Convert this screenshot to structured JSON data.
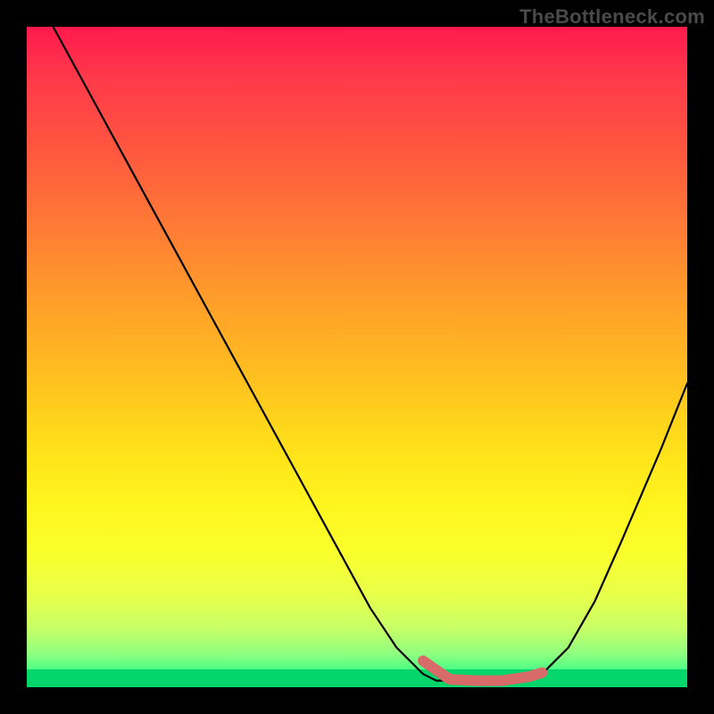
{
  "watermark": "TheBottleneck.com",
  "chart_data": {
    "type": "line",
    "title": "",
    "xlabel": "",
    "ylabel": "",
    "xlim": [
      0,
      100
    ],
    "ylim": [
      0,
      100
    ],
    "grid": false,
    "legend": false,
    "series": [
      {
        "name": "bottleneck-curve",
        "x": [
          4,
          10,
          16,
          22,
          28,
          34,
          40,
          46,
          52,
          56,
          60,
          62,
          66,
          70,
          74,
          78,
          82,
          86,
          90,
          96,
          100
        ],
        "values": [
          100,
          89,
          78,
          67,
          56,
          45,
          34,
          23,
          12,
          6,
          2,
          1,
          1,
          1,
          1,
          2,
          6,
          13,
          22,
          36,
          46
        ]
      }
    ],
    "highlight": {
      "name": "optimal-range",
      "x": [
        60,
        64,
        68,
        72,
        76,
        78
      ],
      "values": [
        4,
        1.2,
        1.0,
        1.0,
        1.6,
        2.2
      ]
    },
    "background_gradient": {
      "top": "#ff1a4d",
      "mid": "#ffe11a",
      "bottom": "#00e676"
    }
  }
}
